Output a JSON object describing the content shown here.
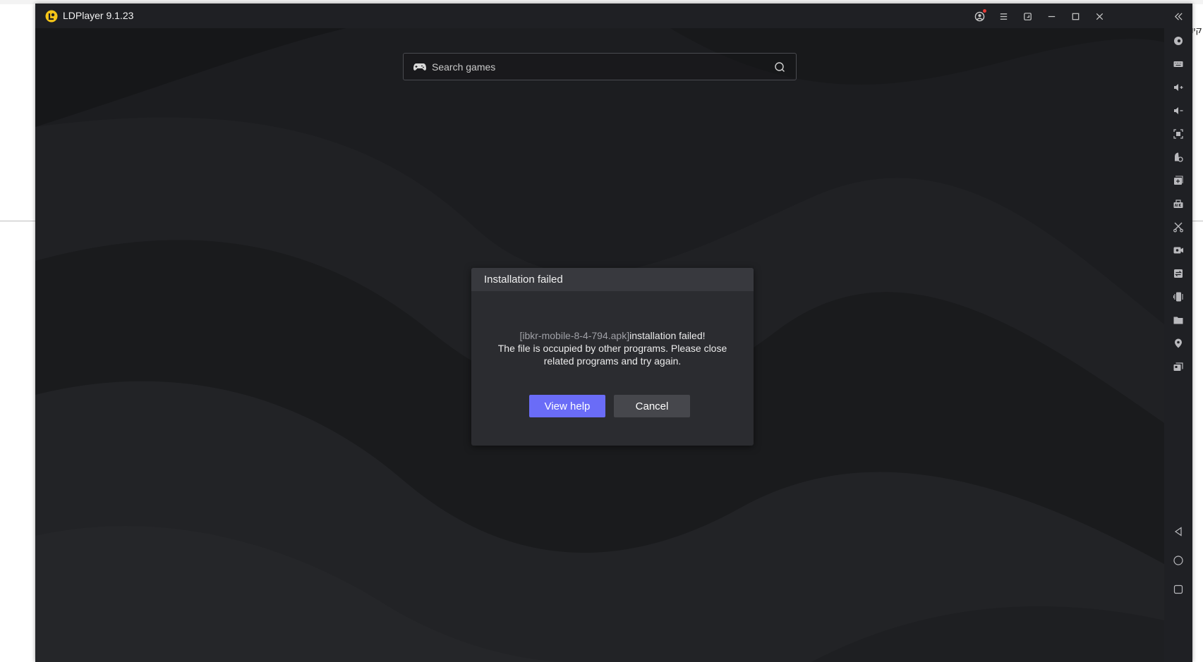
{
  "window": {
    "title": "LDPlayer 9.1.23",
    "accent_color": "#6a6cf7",
    "logo_color": "#f5c518"
  },
  "titlebar": {
    "buttons": [
      "user-icon",
      "menu-icon",
      "restore-small-icon",
      "minimize-icon",
      "maximize-icon",
      "close-icon",
      "collapse-sidebar-icon"
    ]
  },
  "search": {
    "placeholder": "Search games"
  },
  "dialog": {
    "title": "Installation failed",
    "file_name": "[ibkr-mobile-8-4-794.apk]",
    "message_line1_suffix": "installation failed!",
    "message_line2": "The file is occupied by other programs. Please close",
    "message_line3": "related programs and try again.",
    "primary_button": "View help",
    "secondary_button": "Cancel"
  },
  "sidebar": {
    "tools": [
      "gamepad-settings-icon",
      "keyboard-mapping-icon",
      "volume-up-icon",
      "volume-down-icon",
      "screenshot-crop-icon",
      "operation-record-icon",
      "multi-instance-icon",
      "apk-install-icon",
      "scissors-icon",
      "video-record-icon",
      "sync-icon",
      "shake-icon",
      "folder-icon",
      "location-icon",
      "multi-window-icon"
    ],
    "nav": [
      "back-icon",
      "home-icon",
      "recent-apps-icon"
    ]
  },
  "desktop": {
    "right_edge_text": "קיו"
  }
}
